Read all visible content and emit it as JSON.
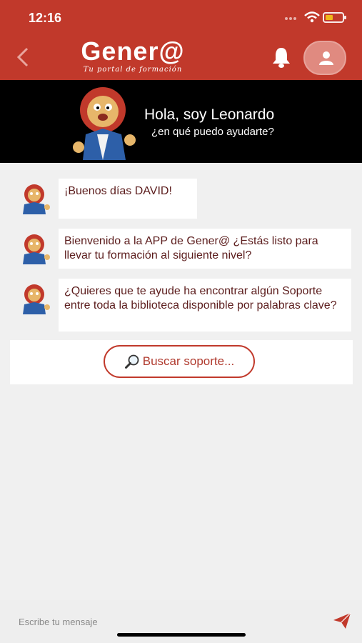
{
  "status_bar": {
    "time": "12:16"
  },
  "header": {
    "brand": "Gener@",
    "tagline": "Tu portal de formación"
  },
  "banner": {
    "title": "Hola, soy Leonardo",
    "subtitle": "¿en qué puedo ayudarte?"
  },
  "messages": [
    {
      "text": "¡Buenos días DAVID!"
    },
    {
      "text": "Bienvenido a la APP de Gener@ ¿Estás listo para llevar tu formación al siguiente nivel?"
    },
    {
      "text": "¿Quieres que te ayude ha encontrar algún Soporte entre toda la biblioteca disponible por palabras clave?"
    }
  ],
  "search_button": {
    "label": "Buscar soporte..."
  },
  "composer": {
    "placeholder": "Escribe tu mensaje"
  },
  "colors": {
    "primary": "#c1392b",
    "banner_bg": "#000000",
    "message_text": "#5b1c1c"
  }
}
